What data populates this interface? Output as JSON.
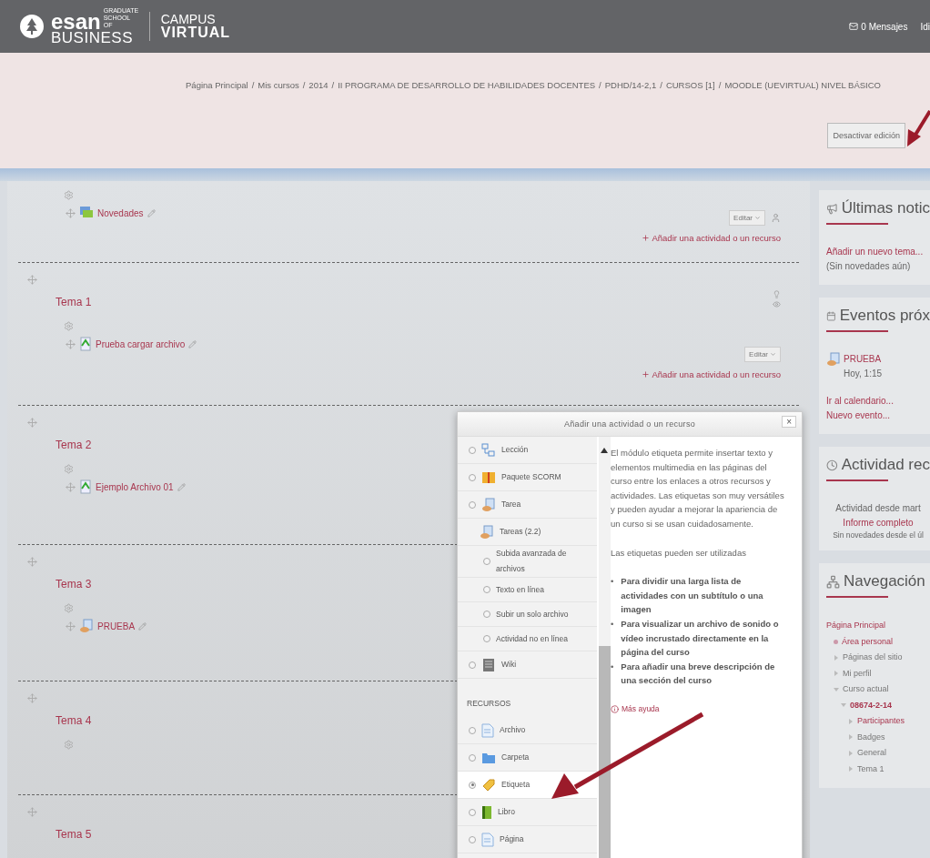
{
  "header": {
    "logo": {
      "brand": "esan",
      "tagline": "GRADUATE SCHOOL OF",
      "sub": "BUSINESS",
      "campus": "CAMPUS",
      "virtual": "VIRTUAL"
    },
    "messages": "0 Mensajes",
    "language": "Idi"
  },
  "breadcrumb": [
    "Página Principal",
    "Mis cursos",
    "2014",
    "II PROGRAMA DE DESARROLLO DE HABILIDADES DOCENTES",
    "PDHD/14-2,1",
    "CURSOS [1]",
    "MOODLE (UEVIRTUAL) NIVEL BÁSICO"
  ],
  "breadcrumb_separator": "/",
  "edit_button": "Desactivar edición",
  "sections": [
    {
      "gear": true,
      "activities": [
        {
          "name": "Novedades",
          "kind": "forum",
          "edit_label": "Editar",
          "group_icon": true
        }
      ],
      "add_link": "Añadir una actividad o un recurso",
      "section_controls": false
    },
    {
      "title": "Tema 1",
      "gear": true,
      "activities": [
        {
          "name": "Prueba cargar archivo",
          "kind": "file",
          "edit_label": "Editar",
          "group_icon": false
        }
      ],
      "add_link": "Añadir una actividad o un recurso",
      "section_controls": true
    },
    {
      "title": "Tema 2",
      "gear": true,
      "activities": [
        {
          "name": "Ejemplo Archivo 01",
          "kind": "file"
        }
      ]
    },
    {
      "title": "Tema 3",
      "gear": true,
      "activities": [
        {
          "name": "PRUEBA",
          "kind": "assign"
        }
      ]
    },
    {
      "title": "Tema 4",
      "gear": true
    },
    {
      "title": "Tema 5",
      "gear": false
    }
  ],
  "modal": {
    "title": "Añadir una actividad o un recurso",
    "close": "×",
    "items": [
      {
        "kind": "lesson",
        "label": "Lección",
        "selected": false
      },
      {
        "kind": "scorm",
        "label": "Paquete SCORM",
        "selected": false
      },
      {
        "kind": "assign",
        "label": "Tarea",
        "selected": false
      },
      {
        "kind": "assign_group",
        "label": "Tareas (2.2)"
      },
      {
        "kind": "subitem",
        "label": "Subida avanzada de archivos",
        "selected": false
      },
      {
        "kind": "subitem",
        "label": "Texto en línea",
        "selected": false
      },
      {
        "kind": "subitem",
        "label": "Subir un solo archivo",
        "selected": false
      },
      {
        "kind": "subitem",
        "label": "Actividad no en línea",
        "selected": false
      },
      {
        "kind": "wiki",
        "label": "Wiki",
        "selected": false
      },
      {
        "kind": "heading",
        "label": "RECURSOS"
      },
      {
        "kind": "file",
        "label": "Archivo",
        "selected": false
      },
      {
        "kind": "folder",
        "label": "Carpeta",
        "selected": false
      },
      {
        "kind": "label",
        "label": "Etiqueta",
        "selected": true
      },
      {
        "kind": "book",
        "label": "Libro",
        "selected": false
      },
      {
        "kind": "page",
        "label": "Página",
        "selected": false
      }
    ],
    "description": [
      "El módulo etiqueta permite insertar texto y elementos multimedia en las páginas del curso entre los enlaces a otros recursos y actividades. Las etiquetas son muy versátiles y pueden ayudar a mejorar la apariencia de un curso si se usan cuidadosamente.",
      "Las etiquetas pueden ser utilizadas"
    ],
    "bullet": "•",
    "bullets": [
      "Para dividir una larga lista de actividades con un subtítulo o una imagen",
      "Para visualizar un archivo de sonido o vídeo incrustado directamente en la página del curso",
      "Para añadir una breve descripción de una sección del curso"
    ],
    "help_link": "Más ayuda"
  },
  "sidebar": [
    {
      "kind": "news",
      "title": "Últimas notic",
      "link": "Añadir un nuevo tema...",
      "note": "(Sin novedades aún)"
    },
    {
      "kind": "events",
      "title": "Eventos próx",
      "event": {
        "name": "PRUEBA",
        "time": "Hoy, 1:15"
      },
      "links": [
        "Ir al calendario...",
        "Nuevo evento..."
      ]
    },
    {
      "kind": "recent",
      "title": "Actividad rec",
      "since": "Actividad desde mart",
      "report": "Informe completo",
      "note": "Sin novedades desde el úl"
    },
    {
      "kind": "navigation",
      "title": "Navegación",
      "tree": [
        {
          "label": "Página Principal",
          "kind": "root",
          "highlighted": true,
          "children": [
            {
              "label": "Área personal",
              "kind": "leaf",
              "highlighted": true
            },
            {
              "label": "Páginas del sitio",
              "kind": "branch",
              "expanded": false,
              "highlighted": false
            },
            {
              "label": "Mi perfil",
              "kind": "branch",
              "expanded": false,
              "highlighted": false
            },
            {
              "label": "Curso actual",
              "kind": "branch",
              "expanded": true,
              "highlighted": false,
              "children": [
                {
                  "label": "08674-2-14",
                  "kind": "branch",
                  "expanded": true,
                  "highlighted": true,
                  "children": [
                    {
                      "label": "Participantes",
                      "kind": "branch",
                      "expanded": false,
                      "highlighted": true
                    },
                    {
                      "label": "Badges",
                      "kind": "branch",
                      "expanded": false,
                      "highlighted": false
                    },
                    {
                      "label": "General",
                      "kind": "branch",
                      "expanded": false,
                      "highlighted": false
                    },
                    {
                      "label": "Tema 1",
                      "kind": "branch",
                      "expanded": false,
                      "highlighted": false
                    }
                  ]
                }
              ]
            }
          ]
        }
      ]
    }
  ]
}
